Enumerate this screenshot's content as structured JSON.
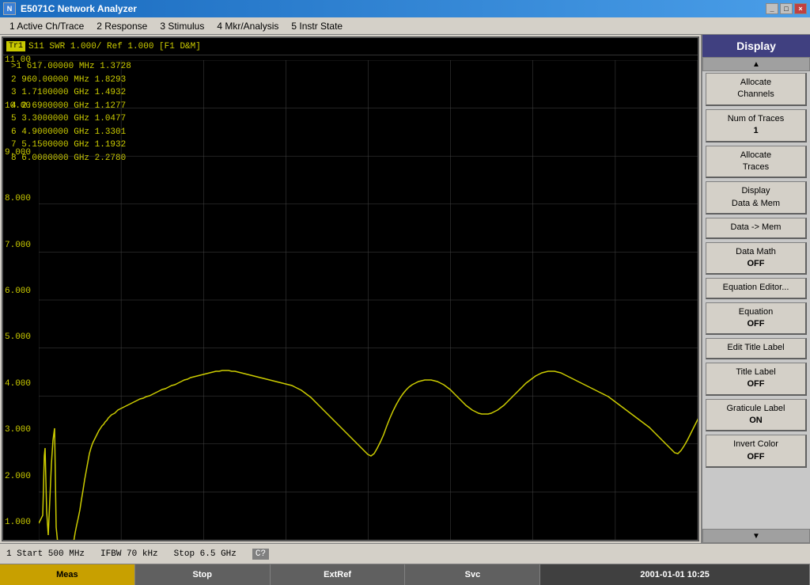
{
  "titleBar": {
    "title": "E5071C Network Analyzer",
    "icon": "N",
    "controls": [
      "_",
      "□",
      "×"
    ]
  },
  "menuBar": {
    "items": [
      "1 Active Ch/Trace",
      "2 Response",
      "3 Stimulus",
      "4 Mkr/Analysis",
      "5 Instr State"
    ]
  },
  "traceHeader": {
    "traceLabel": "Tr1",
    "info": "S11  SWR 1.000/  Ref 1.000  [F1 D&M]"
  },
  "markers": [
    {
      "num": ">1",
      "freq": "617.00000 MHz",
      "val": "1.3728"
    },
    {
      "num": "2",
      "freq": "960.00000 MHz",
      "val": "1.8293"
    },
    {
      "num": "3",
      "freq": "1.7100000 GHz",
      "val": "1.4932"
    },
    {
      "num": "4",
      "freq": "2.6900000 GHz",
      "val": "1.1277"
    },
    {
      "num": "5",
      "freq": "3.3000000 GHz",
      "val": "1.0477"
    },
    {
      "num": "6",
      "freq": "4.9000000 GHz",
      "val": "1.3301"
    },
    {
      "num": "7",
      "freq": "5.1500000 GHz",
      "val": "1.1932"
    },
    {
      "num": "8",
      "freq": "6.0000000 GHz",
      "val": "2.2780"
    }
  ],
  "yAxis": {
    "labels": [
      "11.00",
      "10.00",
      "9.000",
      "8.000",
      "7.000",
      "6.000",
      "5.000",
      "4.000",
      "3.000",
      "2.000",
      "1.000"
    ]
  },
  "statusBar": {
    "start": "1  Start 500 MHz",
    "ifbw": "IFBW 70 kHz",
    "stop": "Stop 6.5 GHz",
    "help": "C?"
  },
  "funcBar": {
    "meas": "Meas",
    "stop": "Stop",
    "extRef": "ExtRef",
    "svc": "Svc",
    "datetime": "2001-01-01  10:25"
  },
  "rightPanel": {
    "title": "Display",
    "buttons": [
      {
        "label": "Allocate\nChannels",
        "sub": ""
      },
      {
        "label": "Num of Traces",
        "sub": "1"
      },
      {
        "label": "Allocate\nTraces",
        "sub": ""
      },
      {
        "label": "Display\nData & Mem",
        "sub": ""
      },
      {
        "label": "Data -> Mem",
        "sub": ""
      },
      {
        "label": "Data Math",
        "sub": "OFF"
      },
      {
        "label": "Equation Editor...",
        "sub": ""
      },
      {
        "label": "Equation",
        "sub": "OFF"
      },
      {
        "label": "Edit Title Label",
        "sub": ""
      },
      {
        "label": "Title Label",
        "sub": "OFF"
      },
      {
        "label": "Graticule Label",
        "sub": "ON"
      },
      {
        "label": "Invert Color",
        "sub": "OFF"
      }
    ]
  }
}
